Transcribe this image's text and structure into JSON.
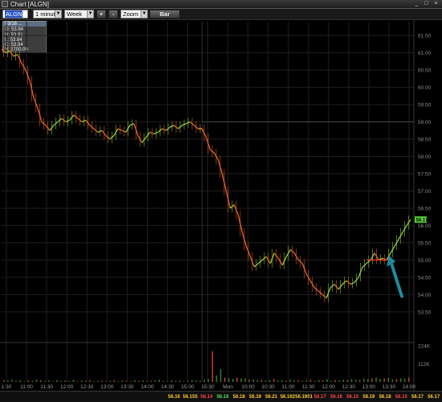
{
  "window": {
    "title": "Chart [ALGN]",
    "buttons": [
      "_",
      "□",
      "×"
    ]
  },
  "toolbar": {
    "symbol": "ALGN",
    "interval": "1 minute",
    "range": "Week",
    "plus_label": "+",
    "minus_label": "-",
    "zoom_label": "Zoom",
    "bar_label": "Bar"
  },
  "ohlc": {
    "header": "03/16 ...",
    "open": "O: 53.84",
    "high": "H: 53.91",
    "low": "L: 53.84",
    "close": "C: 53.84",
    "volume": "V: 2700.00"
  },
  "chart_data": {
    "type": "line",
    "title": "",
    "price_ticks": [
      "61.50",
      "61.00",
      "60.50",
      "60.00",
      "59.50",
      "59.00",
      "58.50",
      "58.00",
      "57.50",
      "57.00",
      "56.50",
      "56.00",
      "55.50",
      "55.00",
      "54.50",
      "54.00",
      "53.50"
    ],
    "ylim": [
      53.1,
      61.9
    ],
    "x_ticks": [
      "1:30",
      "11:00",
      "11:30",
      "12:00",
      "12:30",
      "13:00",
      "13:30",
      "14:00",
      "14:30",
      "15:00",
      "15:30",
      "Mon",
      "10:00",
      "10:30",
      "11:00",
      "11:30",
      "12:00",
      "12:30",
      "13:00",
      "13:30",
      "14:00"
    ],
    "last_price_label": "56.17",
    "reference_line": 59.0,
    "breakout_level": 55.0,
    "prices": [
      [
        0,
        61.1
      ],
      [
        2,
        61.0
      ],
      [
        4,
        61.05
      ],
      [
        6,
        60.9
      ],
      [
        8,
        60.95
      ],
      [
        10,
        60.7
      ],
      [
        12,
        60.5
      ],
      [
        14,
        60.2
      ],
      [
        16,
        59.7
      ],
      [
        18,
        59.4
      ],
      [
        20,
        59.0
      ],
      [
        22,
        58.9
      ],
      [
        24,
        58.75
      ],
      [
        26,
        58.9
      ],
      [
        28,
        59.0
      ],
      [
        30,
        59.1
      ],
      [
        32,
        59.0
      ],
      [
        34,
        59.05
      ],
      [
        36,
        59.2
      ],
      [
        38,
        59.1
      ],
      [
        40,
        59.0
      ],
      [
        42,
        59.05
      ],
      [
        44,
        58.9
      ],
      [
        46,
        58.8
      ],
      [
        48,
        58.7
      ],
      [
        50,
        58.75
      ],
      [
        52,
        58.6
      ],
      [
        54,
        58.5
      ],
      [
        56,
        58.6
      ],
      [
        58,
        58.8
      ],
      [
        60,
        58.75
      ],
      [
        62,
        58.7
      ],
      [
        64,
        58.9
      ],
      [
        66,
        58.95
      ],
      [
        68,
        58.6
      ],
      [
        70,
        58.4
      ],
      [
        72,
        58.55
      ],
      [
        74,
        58.7
      ],
      [
        76,
        58.65
      ],
      [
        78,
        58.7
      ],
      [
        80,
        58.8
      ],
      [
        82,
        58.75
      ],
      [
        84,
        58.85
      ],
      [
        86,
        58.9
      ],
      [
        88,
        58.8
      ],
      [
        90,
        58.9
      ],
      [
        92,
        58.95
      ],
      [
        94,
        59.0
      ],
      [
        96,
        58.9
      ],
      [
        98,
        58.8
      ],
      [
        100,
        58.8
      ],
      [
        102,
        58.55
      ],
      [
        104,
        58.2
      ],
      [
        106,
        58.1
      ],
      [
        108,
        57.9
      ],
      [
        110,
        57.5
      ],
      [
        112,
        57.0
      ],
      [
        114,
        56.5
      ],
      [
        116,
        56.6
      ],
      [
        118,
        56.3
      ],
      [
        120,
        55.8
      ],
      [
        122,
        55.4
      ],
      [
        124,
        55.1
      ],
      [
        126,
        54.8
      ],
      [
        128,
        54.9
      ],
      [
        130,
        55.0
      ],
      [
        132,
        55.1
      ],
      [
        134,
        54.9
      ],
      [
        136,
        55.2
      ],
      [
        138,
        55.05
      ],
      [
        140,
        54.85
      ],
      [
        142,
        55.1
      ],
      [
        144,
        55.3
      ],
      [
        146,
        55.2
      ],
      [
        148,
        55.0
      ],
      [
        150,
        54.9
      ],
      [
        152,
        54.6
      ],
      [
        154,
        54.4
      ],
      [
        156,
        54.2
      ],
      [
        158,
        54.1
      ],
      [
        160,
        54.0
      ],
      [
        162,
        53.9
      ],
      [
        164,
        54.2
      ],
      [
        166,
        54.3
      ],
      [
        168,
        54.15
      ],
      [
        170,
        54.3
      ],
      [
        172,
        54.4
      ],
      [
        174,
        54.3
      ],
      [
        176,
        54.35
      ],
      [
        178,
        54.5
      ],
      [
        180,
        54.8
      ],
      [
        182,
        54.9
      ],
      [
        184,
        55.0
      ],
      [
        186,
        55.2
      ],
      [
        188,
        55.0
      ],
      [
        190,
        55.05
      ],
      [
        192,
        55.0
      ],
      [
        194,
        55.2
      ],
      [
        196,
        55.4
      ],
      [
        198,
        55.6
      ],
      [
        200,
        55.8
      ],
      [
        202,
        56.0
      ],
      [
        204,
        56.17
      ]
    ],
    "volume_ticks": [
      "224K",
      "112K"
    ],
    "volumes": [
      0.05,
      0.04,
      0.06,
      0.03,
      0.05,
      0.02,
      0.04,
      0.03,
      0.06,
      0.05,
      0.03,
      0.04,
      0.02,
      0.05,
      0.03,
      0.04,
      0.03,
      0.06,
      0.02,
      0.04,
      0.03,
      0.05,
      0.02,
      0.03,
      0.04,
      0.02,
      0.03,
      0.05,
      0.02,
      0.04,
      0.03,
      0.02,
      0.05,
      0.03,
      0.04,
      0.02,
      0.03,
      0.04,
      0.06,
      0.03,
      0.02,
      0.05,
      0.03,
      0.04,
      0.02,
      0.03,
      0.05,
      0.04,
      0.03,
      0.06,
      0.08,
      0.85,
      0.18,
      0.35,
      0.12,
      0.1,
      0.08,
      0.12,
      0.09,
      0.1,
      0.06,
      0.07,
      0.05,
      0.06,
      0.04,
      0.05,
      0.08,
      0.04,
      0.05,
      0.03,
      0.06,
      0.04,
      0.05,
      0.03,
      0.04,
      0.06,
      0.03,
      0.05,
      0.04,
      0.07,
      0.03,
      0.05,
      0.04,
      0.06,
      0.05,
      0.08,
      0.06,
      0.05,
      0.09,
      0.07,
      0.1,
      0.12,
      0.08,
      0.09,
      0.11,
      0.07,
      0.08,
      0.1,
      0.09,
      0.12
    ]
  },
  "footer": {
    "cells": [
      {
        "text": "56.16",
        "color": "#ffcc33"
      },
      {
        "text": "56.155",
        "color": "#ffcc33"
      },
      {
        "text": "56.14",
        "color": "#ff4444"
      },
      {
        "text": "56.18",
        "color": "#55dd55"
      },
      {
        "text": "56.18",
        "color": "#ffcc33"
      },
      {
        "text": "56.19",
        "color": "#ffcc33"
      },
      {
        "text": "56.21",
        "color": "#ffcc33"
      },
      {
        "text": "56.192",
        "color": "#ffcc33"
      },
      {
        "text": "56.1901",
        "color": "#ffcc33"
      },
      {
        "text": "56.17",
        "color": "#ff4444"
      },
      {
        "text": "56.16",
        "color": "#ff4444"
      },
      {
        "text": "56.15",
        "color": "#ff4444"
      },
      {
        "text": "56.19",
        "color": "#ffcc33"
      },
      {
        "text": "56.18",
        "color": "#ffcc33"
      },
      {
        "text": "56.15",
        "color": "#ff4444"
      },
      {
        "text": "56.17",
        "color": "#ffcc33"
      },
      {
        "text": "56.17",
        "color": "#ffcc33"
      }
    ]
  },
  "colors": {
    "up": "#8fd13a",
    "down": "#e8632a",
    "flat": "#d8b22f",
    "grid": "#1f1f1f",
    "arrow": "#1f8a9e",
    "price_axis": "#8a8a8a",
    "badge": "#55d13a"
  }
}
